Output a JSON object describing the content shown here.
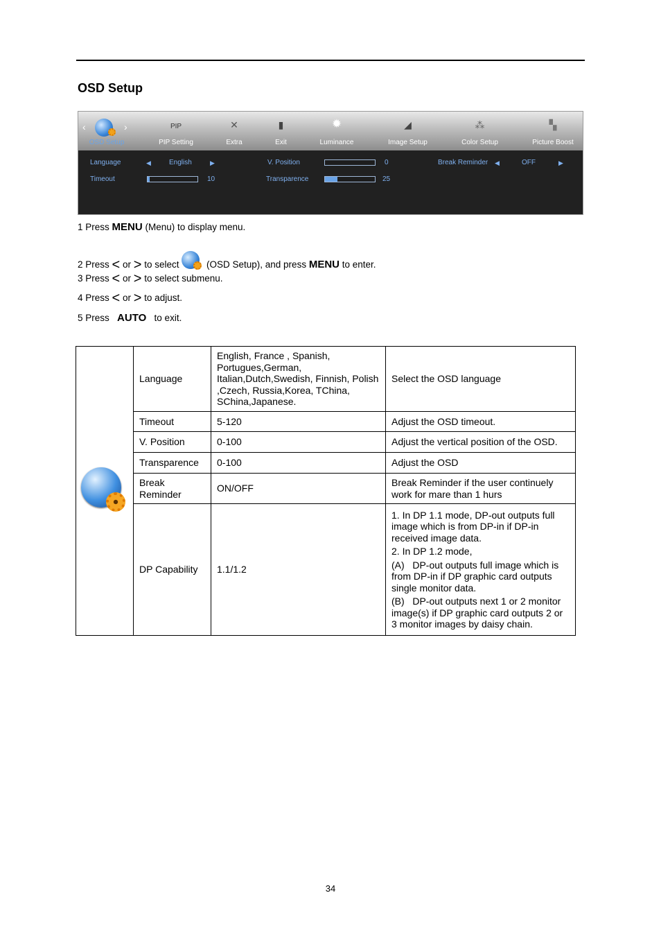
{
  "section_title": "OSD Setup",
  "osd": {
    "tabs": [
      {
        "label": "OSD Setup",
        "icon": "globe-gear-icon",
        "active": true
      },
      {
        "label": "PIP Setting",
        "icon": "pip-icon",
        "icon_text": "PIP"
      },
      {
        "label": "Extra",
        "icon": "tools-icon"
      },
      {
        "label": "Exit",
        "icon": "exit-door-icon"
      },
      {
        "label": "Luminance",
        "icon": "sun-icon"
      },
      {
        "label": "Image Setup",
        "icon": "image-setup-icon"
      },
      {
        "label": "Color Setup",
        "icon": "color-balls-icon"
      },
      {
        "label": "Picture Boost",
        "icon": "picture-boost-icon"
      }
    ],
    "language_label": "Language",
    "language_value": "English",
    "timeout_label": "Timeout",
    "timeout_value": "10",
    "timeout_fraction": 0.04,
    "vposition_label": "V. Position",
    "vposition_value": "0",
    "vposition_fraction": 0,
    "transparence_label": "Transparence",
    "transparence_value": "25",
    "transparence_fraction": 0.25,
    "break_reminder_label": "Break Reminder",
    "break_reminder_value": "OFF",
    "accent_color": "#6aa3e6"
  },
  "steps": [
    {
      "pre": "1 Press ",
      "key": "MENU",
      "post": " (Menu) to display menu."
    },
    {
      "pre": "2 Press ",
      "or": " or ",
      "mid": " to select ",
      "post1": " (OSD Setup), and press ",
      "key": "MENU",
      "post2": " to enter."
    },
    {
      "pre": "3 Press ",
      "or": " or ",
      "post": " to select submenu."
    },
    {
      "pre": "4 Press ",
      "or": " or ",
      "post": " to adjust."
    },
    {
      "pre": "5 Press ",
      "key": "AUTO",
      "post": " to exit."
    }
  ],
  "table": {
    "rows": [
      {
        "name": "Language",
        "range": "English, France , Spanish, Portugues,German, Italian,Dutch,Swedish, Finnish, Polish ,Czech, Russia,Korea, TChina, SChina,Japanese.",
        "desc": [
          "Select the OSD language"
        ]
      },
      {
        "name": "Timeout",
        "range": "5-120",
        "desc": [
          "Adjust the OSD timeout."
        ]
      },
      {
        "name": "V. Position",
        "range": "0-100",
        "desc": [
          "Adjust the vertical position of the OSD."
        ]
      },
      {
        "name": "Transparence",
        "range": "0-100",
        "desc": [
          "Adjust the OSD"
        ]
      },
      {
        "name": "Break Reminder",
        "range": "ON/OFF",
        "desc": [
          "Break Reminder if the user continuely work for mare than 1 hurs"
        ]
      },
      {
        "name": "DP Capability",
        "range": "1.1/1.2",
        "desc": [
          "1. In DP 1.1 mode, DP-out outputs full image which is from DP-in if DP-in received image data.",
          "2. In DP 1.2 mode,",
          "(A)   DP-out outputs full image which is from DP-in if DP graphic card outputs single monitor data.",
          "(B)   DP-out outputs next 1 or 2 monitor image(s) if DP graphic card outputs 2 or 3 monitor images by daisy chain."
        ]
      }
    ]
  },
  "page_number": "34"
}
